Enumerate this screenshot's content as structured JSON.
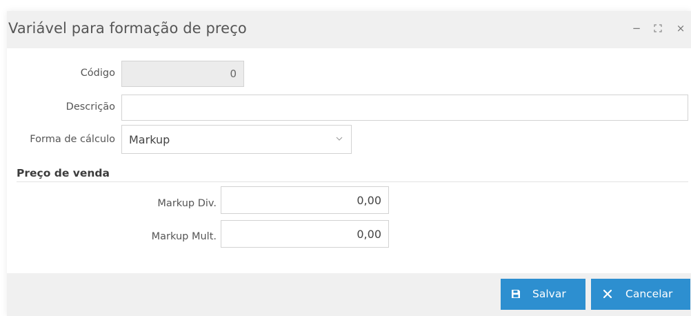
{
  "window": {
    "title": "Variável para formação de preço",
    "minimize_glyph": "−",
    "maximize_glyph": "⛶",
    "close_glyph": "×"
  },
  "form": {
    "codigo": {
      "label": "Código",
      "value": "0"
    },
    "descricao": {
      "label": "Descrição",
      "value": ""
    },
    "forma_calculo": {
      "label": "Forma de cálculo",
      "value": "Markup"
    }
  },
  "preco_venda": {
    "section_title": "Preço de venda",
    "markup_div": {
      "label": "Markup Div.",
      "value": "0,00"
    },
    "markup_mult": {
      "label": "Markup Mult.",
      "value": "0,00"
    }
  },
  "footer": {
    "save_label": "Salvar",
    "cancel_label": "Cancelar"
  },
  "colors": {
    "primary_button": "#2d8fd0",
    "titlebar_bg": "#f0f0f0",
    "readonly_bg": "#ececec"
  },
  "icons": {
    "save": "floppy-disk-icon",
    "cancel": "close-icon",
    "select": "chevron-down-icon"
  }
}
